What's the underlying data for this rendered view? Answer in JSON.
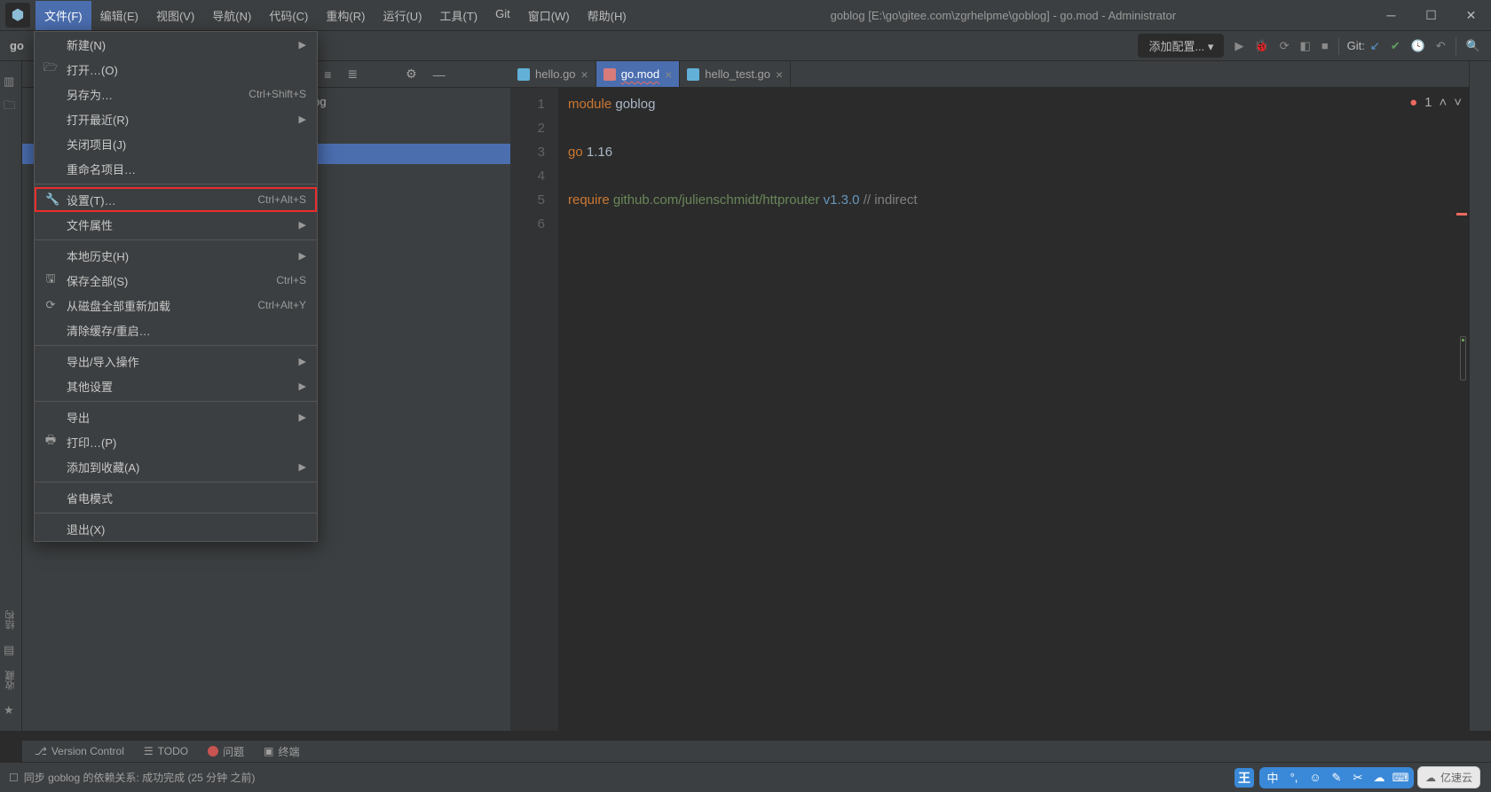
{
  "title": "goblog [E:\\go\\gitee.com\\zgrhelpme\\goblog] - go.mod - Administrator",
  "menubar": [
    "文件(F)",
    "编辑(E)",
    "视图(V)",
    "导航(N)",
    "代码(C)",
    "重构(R)",
    "运行(U)",
    "工具(T)",
    "Git",
    "窗口(W)",
    "帮助(H)"
  ],
  "toolbar": {
    "project": "go",
    "run_config": "添加配置...",
    "git_label": "Git:"
  },
  "file_menu": [
    {
      "type": "item",
      "label": "新建(N)",
      "arrow": true
    },
    {
      "type": "item",
      "label": "打开…(O)",
      "icon": "folder"
    },
    {
      "type": "item",
      "label": "另存为…",
      "shortcut": "Ctrl+Shift+S"
    },
    {
      "type": "item",
      "label": "打开最近(R)",
      "arrow": true
    },
    {
      "type": "item",
      "label": "关闭项目(J)"
    },
    {
      "type": "item",
      "label": "重命名项目…"
    },
    {
      "type": "divider"
    },
    {
      "type": "item",
      "label": "设置(T)…",
      "shortcut": "Ctrl+Alt+S",
      "icon": "wrench",
      "highlight": true
    },
    {
      "type": "item",
      "label": "文件属性",
      "arrow": true
    },
    {
      "type": "divider"
    },
    {
      "type": "item",
      "label": "本地历史(H)",
      "arrow": true
    },
    {
      "type": "item",
      "label": "保存全部(S)",
      "shortcut": "Ctrl+S",
      "icon": "save"
    },
    {
      "type": "item",
      "label": "从磁盘全部重新加载",
      "shortcut": "Ctrl+Alt+Y",
      "icon": "reload"
    },
    {
      "type": "item",
      "label": "清除缓存/重启…"
    },
    {
      "type": "divider"
    },
    {
      "type": "item",
      "label": "导出/导入操作",
      "arrow": true
    },
    {
      "type": "item",
      "label": "其他设置",
      "arrow": true
    },
    {
      "type": "divider"
    },
    {
      "type": "item",
      "label": "导出",
      "arrow": true
    },
    {
      "type": "item",
      "label": "打印…(P)",
      "icon": "print"
    },
    {
      "type": "item",
      "label": "添加到收藏(A)",
      "arrow": true
    },
    {
      "type": "divider"
    },
    {
      "type": "item",
      "label": "省电模式"
    },
    {
      "type": "divider"
    },
    {
      "type": "item",
      "label": "退出(X)"
    }
  ],
  "breadcrumb_tail": "\\goblog",
  "tabs": [
    {
      "name": "hello.go",
      "icon": "go"
    },
    {
      "name": "go.mod",
      "icon": "mod",
      "active": true
    },
    {
      "name": "hello_test.go",
      "icon": "go"
    }
  ],
  "editor": {
    "lines": [
      "1",
      "2",
      "3",
      "4",
      "5",
      "6"
    ],
    "l1a": "module",
    "l1b": " goblog",
    "l3a": "go",
    "l3b": " 1.16",
    "l5a": "require",
    "l5b": " github.com/julienschmidt/httprouter",
    "l5c": " v1.3.0",
    "l5d": " // indirect",
    "error_count": "1"
  },
  "bottom_tabs": {
    "vc": "Version Control",
    "todo": "TODO",
    "problems": "问题",
    "terminal": "终端"
  },
  "leftside": {
    "struct": "结构",
    "fav": "收藏"
  },
  "status": "同步 goblog 的依赖关系: 成功完成 (25 分钟 之前)",
  "tray_brand": "亿速云",
  "tray_wang": "王",
  "tray_zhong": "中"
}
